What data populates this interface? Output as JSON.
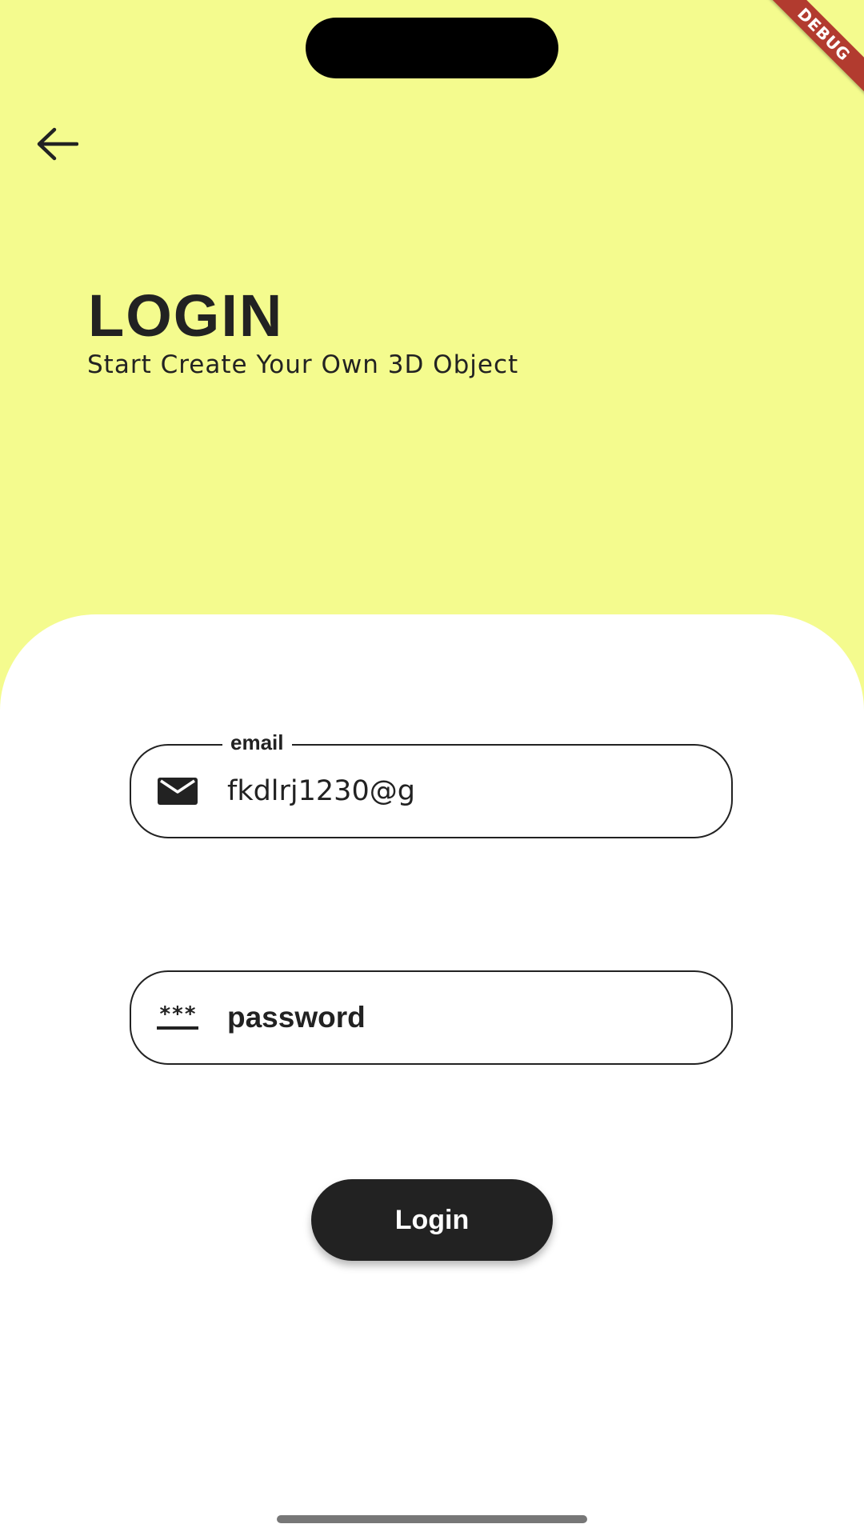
{
  "status": {
    "debug_banner": "DEBUG"
  },
  "header": {
    "back_icon": "arrow-left-icon",
    "title": "LOGIN",
    "subtitle": "Start Create Your Own 3D Object"
  },
  "form": {
    "email": {
      "label": "email",
      "value": "fkdlrj1230@g",
      "icon": "mail-icon"
    },
    "password": {
      "placeholder": "password",
      "icon": "password-icon"
    },
    "submit_label": "Login"
  },
  "colors": {
    "background": "#F4FB8E",
    "card": "#FFFFFF",
    "text": "#222222",
    "button": "#222222",
    "debug_banner": "#B23B2F"
  }
}
